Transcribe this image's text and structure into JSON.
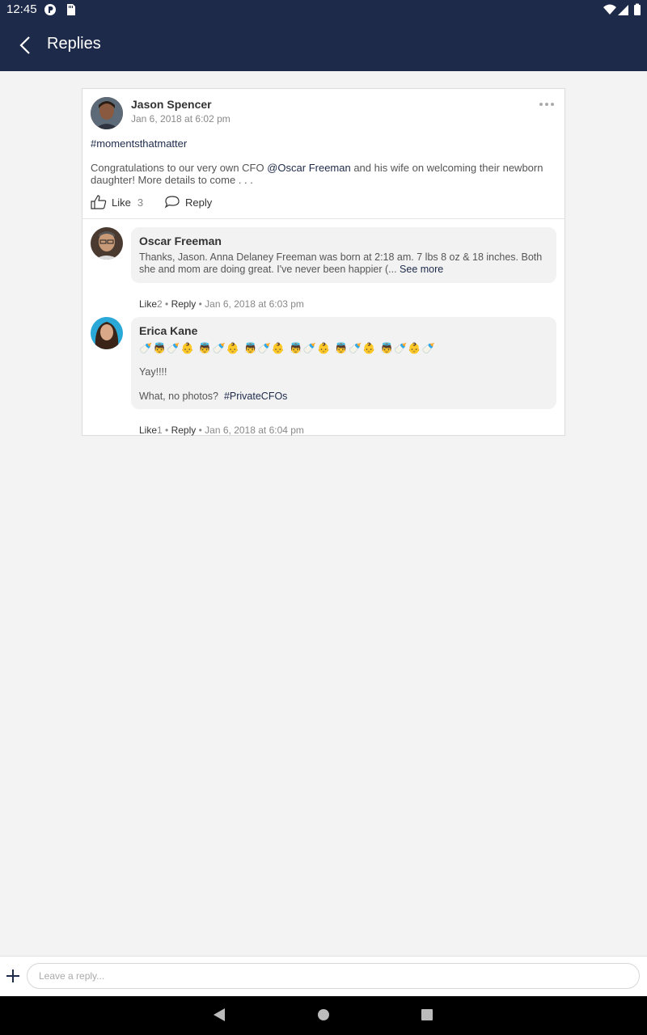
{
  "status_bar": {
    "time": "12:45"
  },
  "app_bar": {
    "title": "Replies"
  },
  "post": {
    "author": "Jason Spencer",
    "date": "Jan 6, 2018 at 6:02 pm",
    "hashtag": "#momentsthatmatter",
    "body_before": "Congratulations to our very own CFO ",
    "mention": "@Oscar Freeman",
    "body_after": " and his wife on welcoming their newborn daughter! More details to come . . .",
    "like_label": "Like",
    "like_count": "3",
    "reply_label": "Reply"
  },
  "replies": [
    {
      "author": "Oscar Freeman",
      "text": "Thanks, Jason.  Anna Delaney Freeman was born at 2:18 am. 7 lbs 8 oz & 18 inches.  Both she and mom are doing great.  I've never been happier (...",
      "see_more": "See more",
      "like_label": "Like",
      "like_count": "2",
      "reply_label": "Reply",
      "date": "Jan 6, 2018 at 6:03 pm"
    },
    {
      "author": "Erica Kane",
      "emoji": "🍼👼🍼👶 👼🍼👶 👼🍼👶 👼🍼👶 👼🍼👶 👼🍼👶🍼",
      "line1": "Yay!!!!",
      "line2": "What, no photos?",
      "hashtag": "#PrivateCFOs",
      "like_label": "Like",
      "like_count": "1",
      "reply_label": "Reply",
      "date": "Jan 6, 2018 at 6:04 pm"
    }
  ],
  "composer": {
    "placeholder": "Leave a reply..."
  },
  "colors": {
    "brand": "#1d2a4a",
    "background": "#f3f3f3"
  }
}
